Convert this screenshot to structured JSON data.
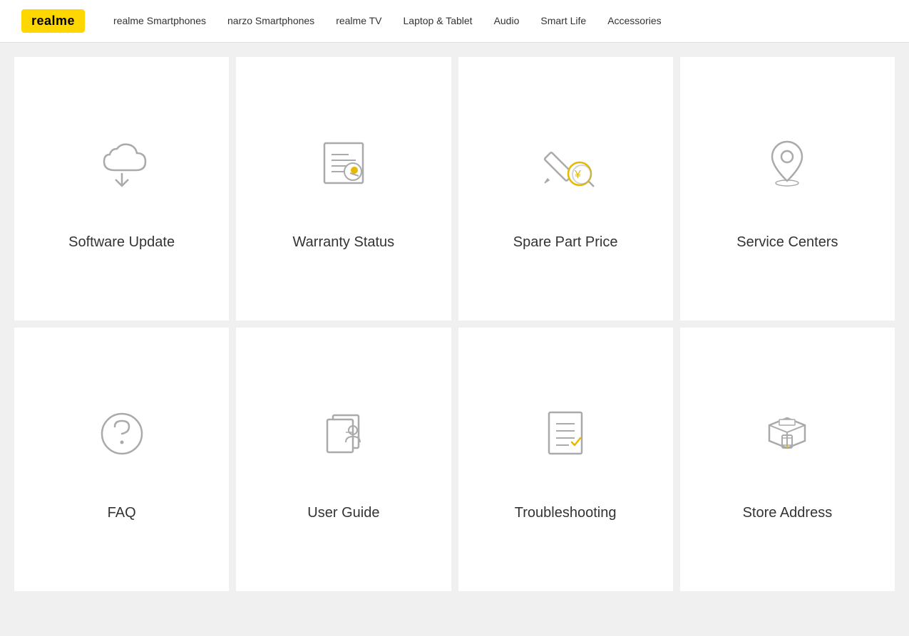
{
  "header": {
    "logo": "realme",
    "nav": [
      {
        "label": "realme Smartphones",
        "id": "nav-realme-smartphones"
      },
      {
        "label": "narzo Smartphones",
        "id": "nav-narzo-smartphones"
      },
      {
        "label": "realme TV",
        "id": "nav-realme-tv"
      },
      {
        "label": "Laptop & Tablet",
        "id": "nav-laptop-tablet"
      },
      {
        "label": "Audio",
        "id": "nav-audio"
      },
      {
        "label": "Smart Life",
        "id": "nav-smart-life"
      },
      {
        "label": "Accessories",
        "id": "nav-accessories"
      }
    ]
  },
  "cards": [
    {
      "id": "software-update",
      "label": "Software Update",
      "icon": "cloud-download"
    },
    {
      "id": "warranty-status",
      "label": "Warranty Status",
      "icon": "warranty"
    },
    {
      "id": "spare-part-price",
      "label": "Spare Part Price",
      "icon": "spare-part"
    },
    {
      "id": "service-centers",
      "label": "Service Centers",
      "icon": "location"
    },
    {
      "id": "faq",
      "label": "FAQ",
      "icon": "question"
    },
    {
      "id": "user-guide",
      "label": "User Guide",
      "icon": "user-guide"
    },
    {
      "id": "troubleshooting",
      "label": "Troubleshooting",
      "icon": "troubleshooting"
    },
    {
      "id": "store-address",
      "label": "Store Address",
      "icon": "store"
    }
  ]
}
